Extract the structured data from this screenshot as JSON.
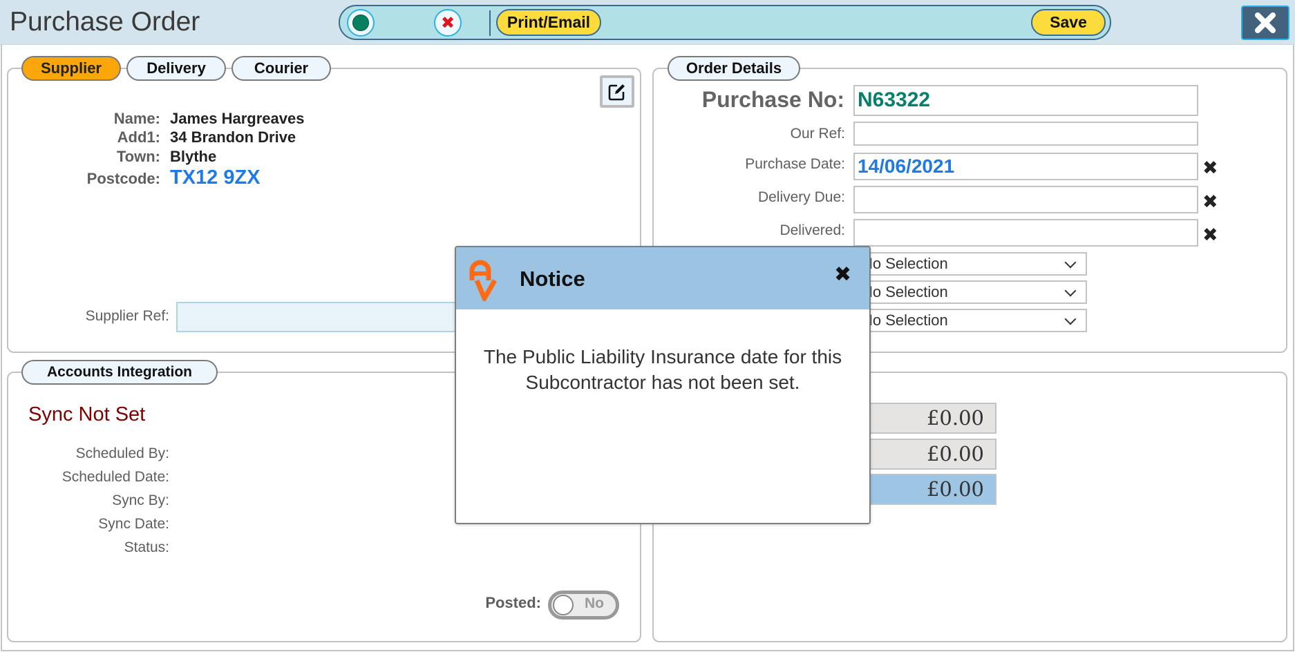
{
  "header": {
    "title": "Purchase Order",
    "toolbar": {
      "status_button_icon": "green-dot-icon",
      "cancel_button_icon": "red-x-icon",
      "print_email_label": "Print/Email",
      "save_label": "Save"
    },
    "close_icon": "close-icon"
  },
  "supplier_panel": {
    "tabs": [
      {
        "label": "Supplier",
        "active": true
      },
      {
        "label": "Delivery",
        "active": false
      },
      {
        "label": "Courier",
        "active": false
      }
    ],
    "edit_icon": "edit-icon",
    "fields": [
      {
        "label": "Name:",
        "value": "James Hargreaves"
      },
      {
        "label": "Add1:",
        "value": "34 Brandon Drive"
      },
      {
        "label": "Town:",
        "value": "Blythe"
      },
      {
        "label": "Postcode:",
        "value": "TX12 9ZX"
      }
    ],
    "supplier_ref": {
      "label": "Supplier Ref:",
      "value": ""
    }
  },
  "order_details": {
    "tab_label": "Order Details",
    "purchase_no": {
      "label": "Purchase No:",
      "value": "N63322"
    },
    "our_ref": {
      "label": "Our Ref:",
      "value": ""
    },
    "purchase_date": {
      "label": "Purchase Date:",
      "value": "14/06/2021"
    },
    "delivery_due": {
      "label": "Delivery Due:",
      "value": ""
    },
    "delivered": {
      "label": "Delivered:",
      "value": ""
    },
    "selects": [
      "No Selection",
      "No Selection",
      "No Selection"
    ]
  },
  "accounts_integration": {
    "tab_label": "Accounts Integration",
    "sync_status": "Sync Not Set",
    "fields": [
      {
        "label": "Scheduled By:",
        "value": ""
      },
      {
        "label": "Scheduled Date:",
        "value": ""
      },
      {
        "label": "Sync By:",
        "value": ""
      },
      {
        "label": "Sync Date:",
        "value": ""
      },
      {
        "label": "Status:",
        "value": ""
      }
    ],
    "posted": {
      "label": "Posted:",
      "value": "No"
    }
  },
  "totals": {
    "amounts": [
      "£0.00",
      "£0.00",
      "£0.00"
    ]
  },
  "modal": {
    "title": "Notice",
    "message": "The Public Liability Insurance date for this Subcontractor has not been set.",
    "close_icon": "close-icon",
    "logo": "av-logo"
  },
  "colors": {
    "accent_orange": "#fba70b",
    "button_yellow": "#fbdc3c",
    "purchase_no_green": "#07806a",
    "date_blue": "#1f7ae6",
    "sync_red": "#800000",
    "header_bg": "#d3e4ec",
    "modal_header": "#9cc3e2"
  }
}
